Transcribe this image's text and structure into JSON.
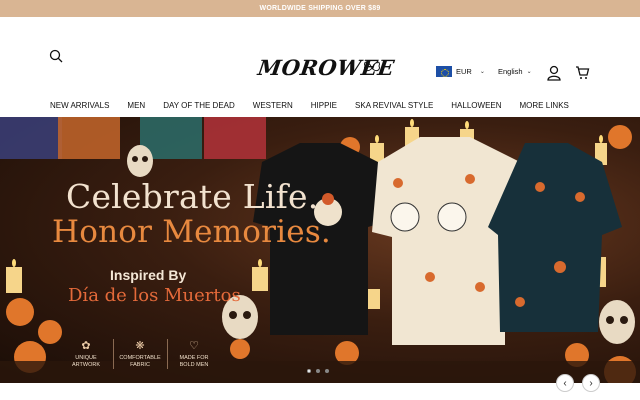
{
  "announcement": "WORLDWIDE SHIPPING OVER $89",
  "header": {
    "logo": "MOROWEE",
    "currency": "EUR",
    "language": "English"
  },
  "nav": [
    "NEW ARRIVALS",
    "MEN",
    "DAY OF THE DEAD",
    "WESTERN",
    "HIPPIE",
    "SKA REVIVAL STYLE",
    "HALLOWEEN",
    "MORE LINKS"
  ],
  "hero": {
    "title_line1": "Celebrate Life.",
    "title_line2": "Honor Memories.",
    "inspired": "Inspired By",
    "subtitle": "Día de los Muertos",
    "features": [
      {
        "line1": "UNIQUE",
        "line2": "ARTWORK",
        "icon": "flower-icon"
      },
      {
        "line1": "COMFORTABLE",
        "line2": "FABRIC",
        "icon": "fabric-icon"
      },
      {
        "line1": "MADE FOR",
        "line2": "BOLD MEN",
        "icon": "heart-icon"
      }
    ],
    "slide_count": 3,
    "active_slide": 1
  },
  "colors": {
    "announce_bg": "#d9b593",
    "accent_orange": "#e8893f",
    "title_cream": "#f2e2cf"
  }
}
